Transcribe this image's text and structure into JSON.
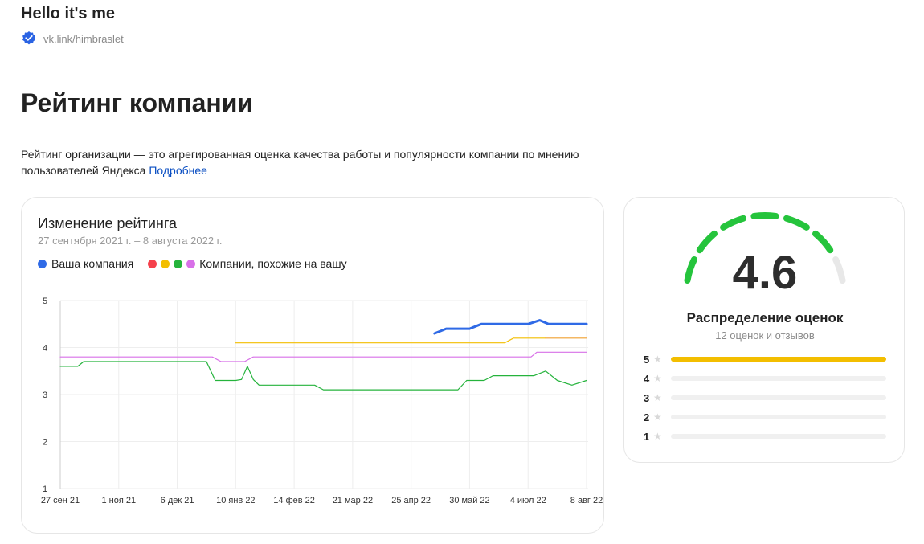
{
  "profile": {
    "name": "Hello it's me",
    "link": "vk.link/himbraslet"
  },
  "page": {
    "title": "Рейтинг компании",
    "description": "Рейтинг организации — это агрегированная оценка качества работы и популярности компании по мнению пользователей Яндекса",
    "more_link": "Подробнее"
  },
  "chart_card": {
    "title": "Изменение рейтинга",
    "subtitle": "27 сентября 2021 г. – 8 августа 2022 г.",
    "legend_own": "Ваша компания",
    "legend_similar": "Компании, похожие на вашу",
    "colors": {
      "own": "#2f6ae6",
      "red": "#f5414c",
      "yellow": "#f3be00",
      "green": "#25b33c",
      "purple": "#d870e8"
    }
  },
  "chart_data": {
    "type": "line",
    "x_ticks": [
      "27 сен 21",
      "1 ноя 21",
      "6 дек 21",
      "10 янв 22",
      "14 фев 22",
      "21 мар 22",
      "25 апр 22",
      "30 май 22",
      "4 июл 22",
      "8 авг 22"
    ],
    "y_ticks": [
      "1",
      "2",
      "3",
      "4",
      "5"
    ],
    "ylim": [
      1,
      5
    ],
    "grid": true,
    "series": [
      {
        "color": "#2f6ae6",
        "points": [
          [
            6.4,
            4.3
          ],
          [
            6.6,
            4.4
          ],
          [
            7.0,
            4.4
          ],
          [
            7.1,
            4.45
          ],
          [
            7.2,
            4.5
          ],
          [
            8.0,
            4.5
          ],
          [
            8.2,
            4.58
          ],
          [
            8.35,
            4.5
          ],
          [
            9.0,
            4.5
          ]
        ]
      },
      {
        "color": "#f3be00",
        "points": [
          [
            3.0,
            4.1
          ],
          [
            7.6,
            4.1
          ],
          [
            7.75,
            4.2
          ],
          [
            8.3,
            4.2
          ]
        ]
      },
      {
        "color": "#f0a030",
        "points": [
          [
            8.3,
            4.2
          ],
          [
            9.0,
            4.2
          ]
        ]
      },
      {
        "color": "#d870e8",
        "points": [
          [
            0.0,
            3.8
          ],
          [
            2.6,
            3.8
          ],
          [
            2.75,
            3.7
          ],
          [
            3.15,
            3.7
          ],
          [
            3.3,
            3.8
          ],
          [
            8.05,
            3.8
          ],
          [
            8.15,
            3.9
          ],
          [
            9.0,
            3.9
          ]
        ]
      },
      {
        "color": "#25b33c",
        "points": [
          [
            0.0,
            3.6
          ],
          [
            0.3,
            3.6
          ],
          [
            0.4,
            3.7
          ],
          [
            2.5,
            3.7
          ],
          [
            2.65,
            3.3
          ],
          [
            3.0,
            3.3
          ],
          [
            3.1,
            3.32
          ],
          [
            3.2,
            3.6
          ],
          [
            3.3,
            3.32
          ],
          [
            3.4,
            3.2
          ],
          [
            4.35,
            3.2
          ],
          [
            4.5,
            3.1
          ],
          [
            6.8,
            3.1
          ],
          [
            6.95,
            3.3
          ],
          [
            7.25,
            3.3
          ],
          [
            7.4,
            3.4
          ],
          [
            8.1,
            3.4
          ],
          [
            8.3,
            3.5
          ],
          [
            8.5,
            3.3
          ],
          [
            8.75,
            3.2
          ],
          [
            9.0,
            3.3
          ]
        ]
      }
    ]
  },
  "rating_card": {
    "value": "4.6",
    "gauge_fraction": 0.92,
    "gauge_color": "#25c43c",
    "dist_title": "Распределение оценок",
    "dist_sub": "12 оценок и отзывов",
    "rows": [
      {
        "stars": "5",
        "fraction": 1.0
      },
      {
        "stars": "4",
        "fraction": 0
      },
      {
        "stars": "3",
        "fraction": 0
      },
      {
        "stars": "2",
        "fraction": 0
      },
      {
        "stars": "1",
        "fraction": 0
      }
    ]
  }
}
